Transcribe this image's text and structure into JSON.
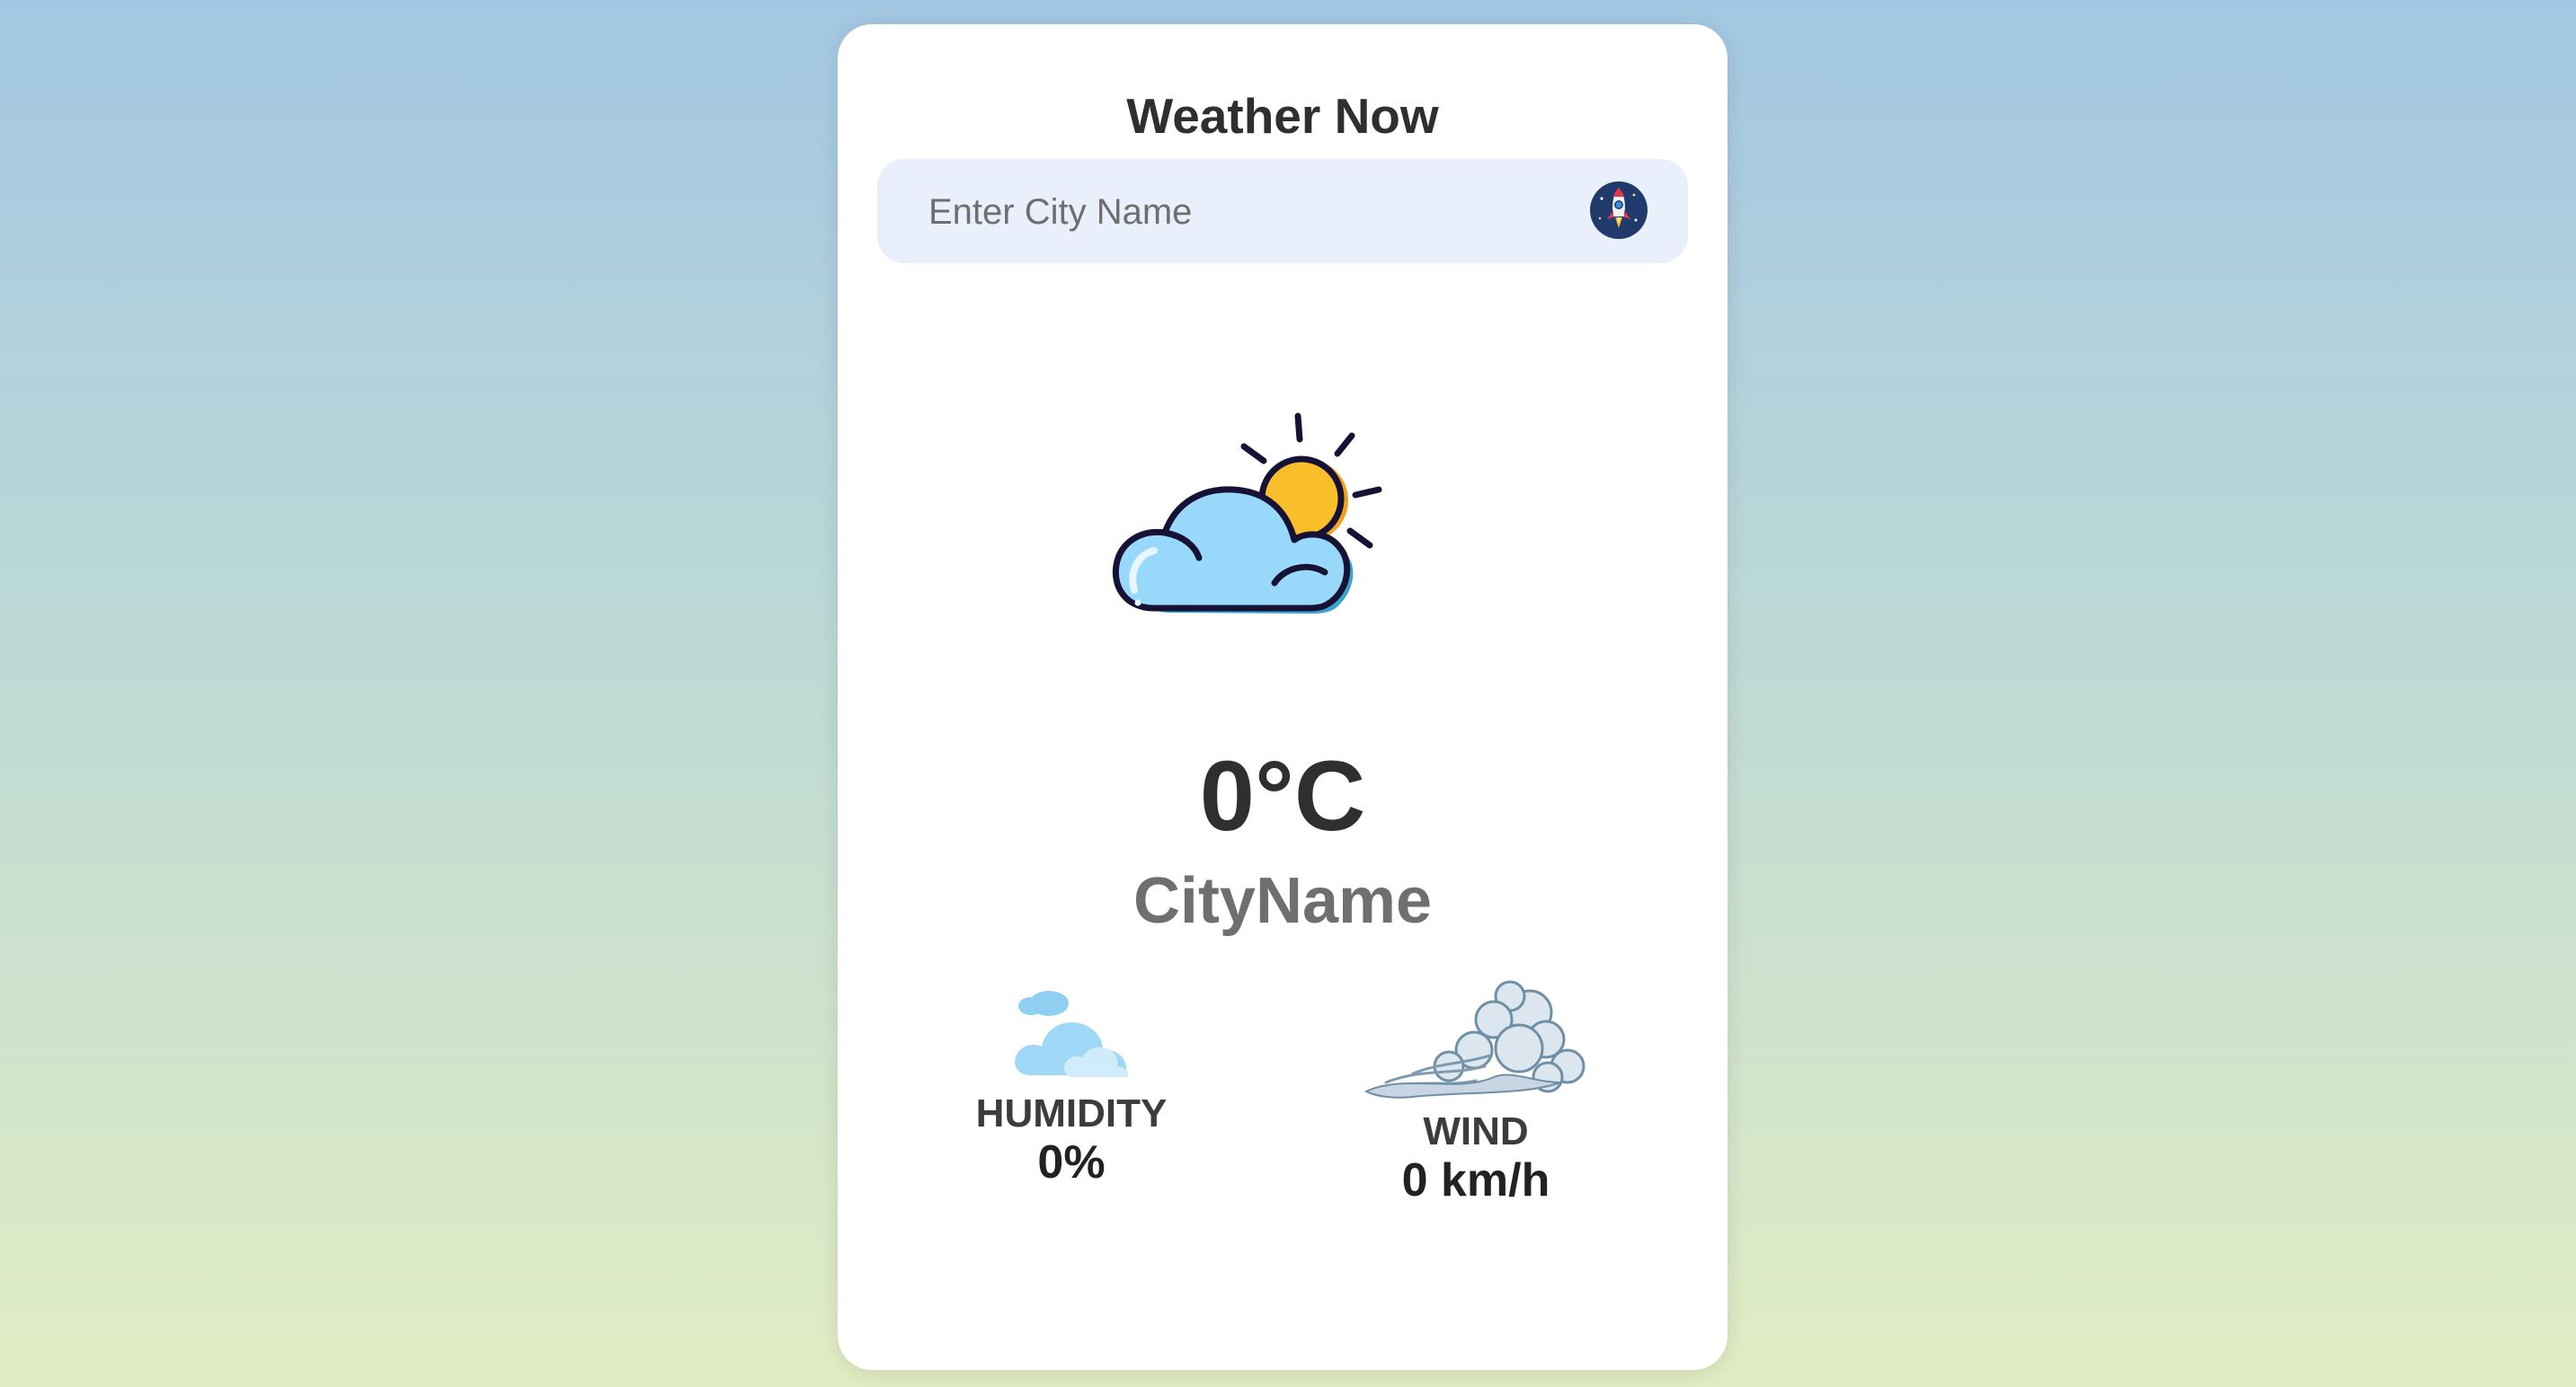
{
  "app": {
    "title": "Weather Now"
  },
  "search": {
    "placeholder": "Enter City Name",
    "value": "",
    "button_icon": "rocket-icon"
  },
  "weather": {
    "icon": "partly-cloudy-icon",
    "temperature": "0°C",
    "city": "CityName"
  },
  "details": {
    "humidity": {
      "icon": "humidity-cloud-icon",
      "label": "HUMIDITY",
      "value": "0%"
    },
    "wind": {
      "icon": "wind-gust-icon",
      "label": "WIND",
      "value": "0 km/h"
    }
  },
  "colors": {
    "background_top": "#a3c7e3",
    "background_bottom": "#e1edc3",
    "card": "#ffffff",
    "search_bar": "#e9f0fb",
    "text_dark": "#2f2f2f",
    "text_muted": "#6f6f6f"
  }
}
